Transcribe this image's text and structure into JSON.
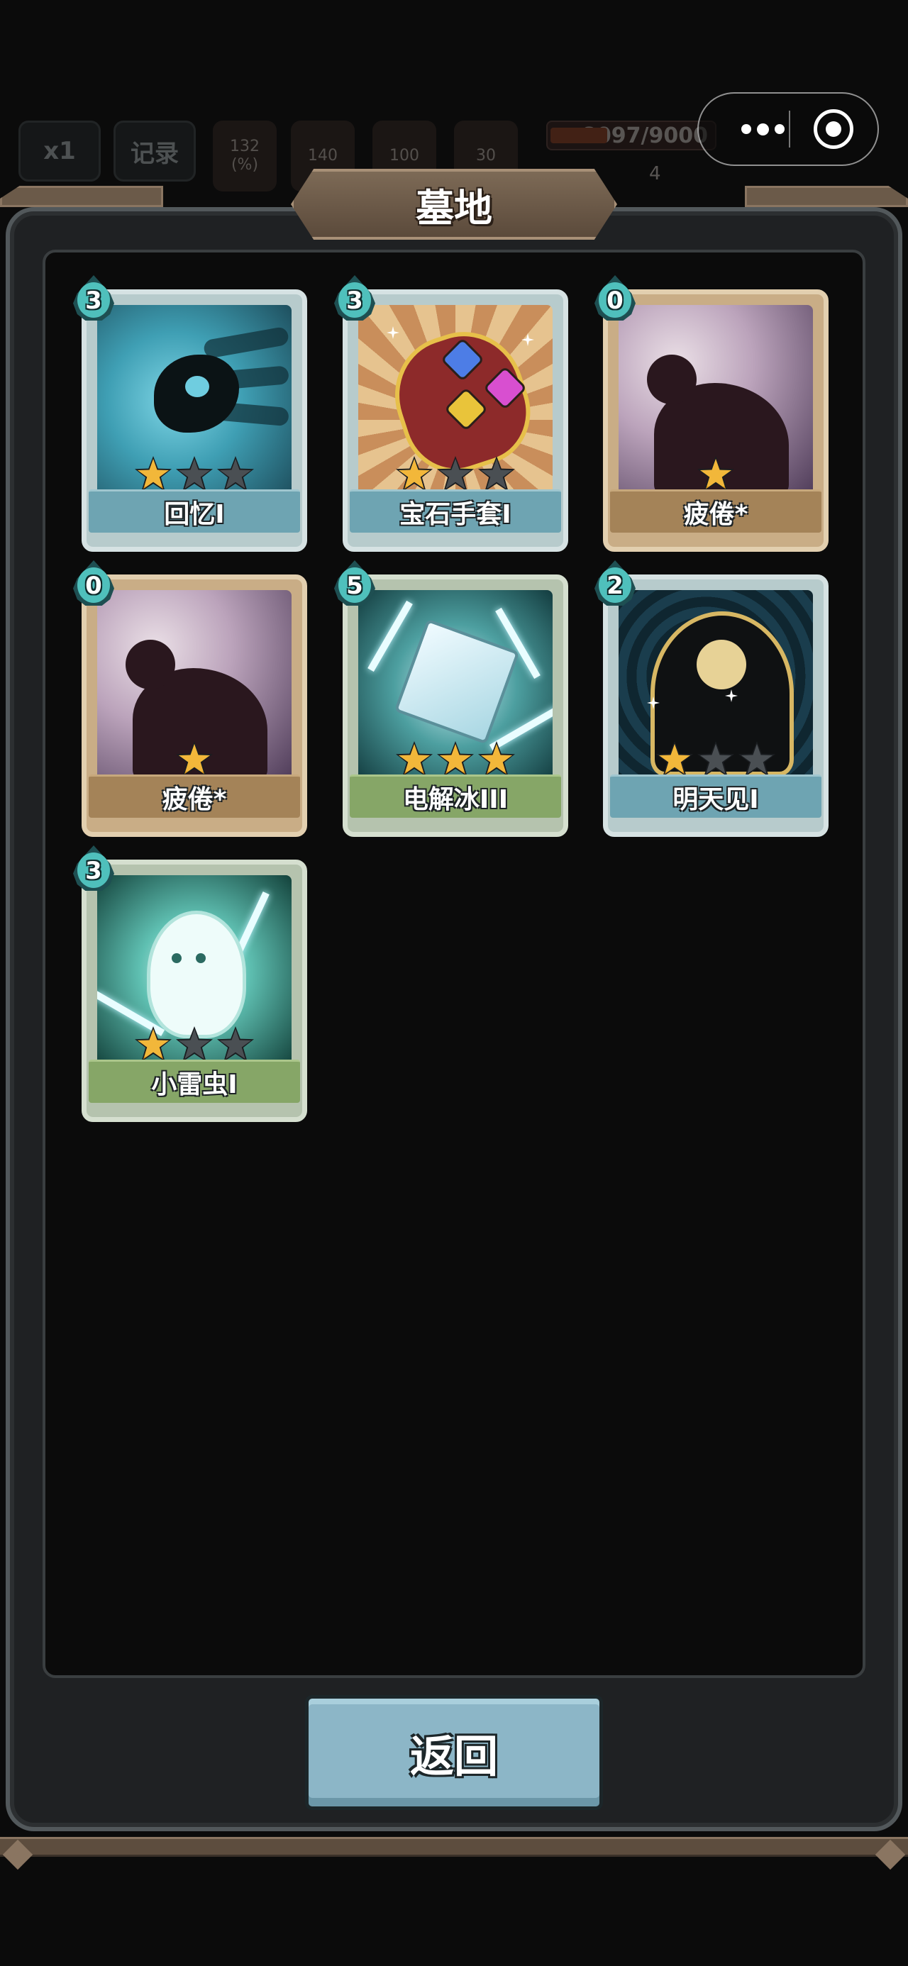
{
  "hud": {
    "speed": "x1",
    "record": "记录",
    "stats": [
      {
        "value": "132",
        "sub": "(%)"
      },
      {
        "value": "140",
        "sub": ""
      },
      {
        "value": "100",
        "sub": ""
      },
      {
        "value": "30",
        "sub": ""
      }
    ],
    "hp": "8097/9000",
    "sub_count": "4"
  },
  "capsule": {
    "menu_icon": "more-dots-icon",
    "close_icon": "target-circle-icon"
  },
  "modal": {
    "title": "墓地",
    "back_label": "返回"
  },
  "cards": [
    {
      "name": "回忆I",
      "cost": "3",
      "stars": 1,
      "max_stars": 3,
      "ribbon": "blue",
      "art": "recall"
    },
    {
      "name": "宝石手套I",
      "cost": "3",
      "stars": 1,
      "max_stars": 3,
      "ribbon": "blue",
      "art": "gauntlet"
    },
    {
      "name": "疲倦*",
      "cost": "0",
      "stars": 1,
      "max_stars": 1,
      "ribbon": "tan",
      "art": "tired"
    },
    {
      "name": "疲倦*",
      "cost": "0",
      "stars": 1,
      "max_stars": 1,
      "ribbon": "tan",
      "art": "tired"
    },
    {
      "name": "电解冰III",
      "cost": "5",
      "stars": 3,
      "max_stars": 3,
      "ribbon": "green",
      "art": "ice"
    },
    {
      "name": "明天见I",
      "cost": "2",
      "stars": 1,
      "max_stars": 3,
      "ribbon": "blue",
      "art": "tomorrow"
    },
    {
      "name": "小雷虫I",
      "cost": "3",
      "stars": 1,
      "max_stars": 3,
      "ribbon": "green",
      "art": "bug"
    }
  ],
  "colors": {
    "star_on": "#f2b73a",
    "star_off": "#4a4f53",
    "ribbon_blue": "#6ea4b2",
    "ribbon_tan": "#a48358",
    "ribbon_green": "#86a667",
    "button": "#8cb6c7"
  }
}
